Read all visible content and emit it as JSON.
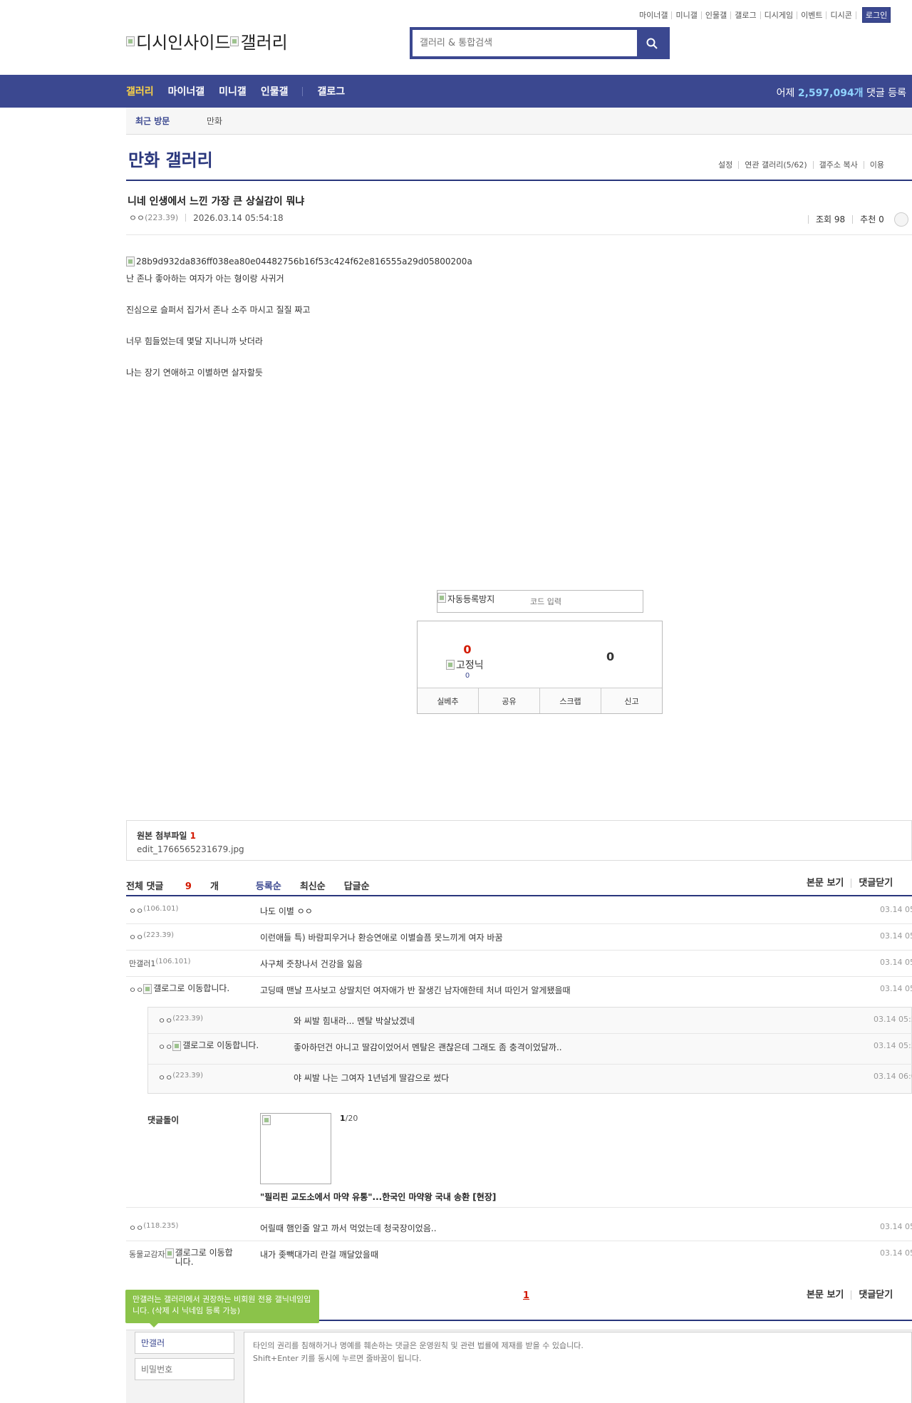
{
  "top_links": [
    "마이너갤",
    "미니갤",
    "인물갤",
    "갤로그",
    "디시게임",
    "이벤트",
    "디시콘"
  ],
  "login_label": "로그인",
  "logo": {
    "alt1": "디시인사이드",
    "alt2": "갤러리"
  },
  "search": {
    "placeholder": "갤러리 & 통합검색"
  },
  "gnb": {
    "items": [
      "갤러리",
      "마이너갤",
      "미니갤",
      "인물갤",
      "갤로그"
    ],
    "right_prefix": "어제 ",
    "right_count": "2,597,094개",
    "right_suffix": " 댓글 등록"
  },
  "recent": {
    "label": "최근 방문",
    "items": [
      "만화"
    ]
  },
  "gallery": {
    "title": "만화 갤러리",
    "options": [
      "설정",
      "연관 갤러리(5/62)",
      "갤주소 복사",
      "이용"
    ]
  },
  "post": {
    "title": "니네 인생에서 느낀 가장 큰 상실감이 뭐냐",
    "author": "ㅇㅇ",
    "ip": "(223.39)",
    "datetime": "2026.03.14 05:54:18",
    "views": "조회 98",
    "recommend": "추천 0",
    "image_alt": "28b9d932da836ff038ea80e04482756b16f53c424f62e816555a29d05800200a",
    "paragraphs": [
      "난 존나 좋아하는 여자가 아는 형이랑 사귀거",
      "진심으로 슬퍼서 집가서 존나 소주 마시고 질질 짜고",
      "너무 힘들었는데 몇달 지나니까 낫더라",
      "나는 장기 연애하고 이별하면 살자할듯"
    ]
  },
  "captcha": {
    "image_alt": "자동등록방지",
    "placeholder": "코드 입력"
  },
  "vote": {
    "up": "0",
    "fixed_alt": "고정닉",
    "fixed_count": "0",
    "down": "0",
    "actions": [
      "실베추",
      "공유",
      "스크랩",
      "신고"
    ]
  },
  "attach": {
    "title": "원본 첨부파일",
    "count": "1",
    "file": "edit_1766565231679.jpg"
  },
  "comments_header": {
    "total_label": "전체 댓글",
    "total_count": "9",
    "total_unit": "개",
    "sorts": [
      "등록순",
      "최신순",
      "답글순"
    ],
    "right": [
      "본문 보기",
      "댓글닫기"
    ]
  },
  "comments": [
    {
      "nick": "ㅇㅇ",
      "ip": "(106.101)",
      "text": "나도 이별 ㅇㅇ",
      "date": "03.14 05"
    },
    {
      "nick": "ㅇㅇ",
      "ip": "(223.39)",
      "text": "이런애들 특) 바람피우거나 환승연애로 이별슬픔 못느끼게 여자 바꿈",
      "date": "03.14 05"
    },
    {
      "nick": "만갤러1",
      "ip": "(106.101)",
      "text": "사구체 줏창나서 건강을 잃음",
      "date": "03.14 05"
    },
    {
      "nick": "ㅇㅇ",
      "lock_alt": "갤로그로 이동합니다.",
      "text": "고딩때 맨날 프사보고 상딸치던 여자애가 반 잘생긴 남자애한테 처녀 따인거 알게됐을때",
      "date": "03.14 05"
    }
  ],
  "replies": [
    {
      "nick": "ㅇㅇ",
      "ip": "(223.39)",
      "text": "와 씨발 힘내라... 멘탈 박살났겠네",
      "date": "03.14 05:5"
    },
    {
      "nick": "ㅇㅇ",
      "lock_alt": "갤로그로 이동합니다.",
      "text": "좋아하던건 아니고 딸감이었어서 멘탈은 괜찮은데 그래도 좀 충격이었달까..",
      "date": "03.14 05:5"
    },
    {
      "nick": "ㅇㅇ",
      "ip": "(223.39)",
      "text": "야 씨발 나는 그여자 1년넘게 딸감으로 썼다",
      "date": "03.14 06:0"
    }
  ],
  "dol": {
    "label": "댓글돌이",
    "page": "1",
    "page_total": "/20",
    "headline": "\"필리핀 교도소에서 마약 유통\"...한국인 마약왕 국내 송환 [현장]"
  },
  "comments2": [
    {
      "nick": "ㅇㅇ",
      "ip": "(118.235)",
      "text": "어릴때 햄인줄 알고 까서 먹었는데 청국장이었음..",
      "date": "03.14 05"
    },
    {
      "nick": "동물교감자",
      "lock_alt": "갤로그로 이동합니다.",
      "text": "내가 좆빽대가리 란걸 깨달았을때",
      "date": "03.14 05"
    }
  ],
  "bottom": {
    "page": "1",
    "right": [
      "본문 보기",
      "댓글닫기"
    ]
  },
  "tooltip": "만갤러는 갤러리에서 권장하는 비회원 전용 갤닉네임입니다. (삭제 시 닉네임 등록 가능)",
  "write": {
    "nick_value": "만갤러",
    "pw_placeholder": "비밀번호",
    "textarea_placeholder": "타인의 권리를 침해하거나 명예를 훼손하는 댓글은 운영원칙 및 관련 법률에 제재를 받을 수 있습니다.\nShift+Enter 키를 동시에 누르면 줄바꿈이 됩니다."
  },
  "colors": {
    "brand": "#3b4890",
    "brand_dark": "#29367c",
    "accent_red": "#d31900",
    "tooltip_green": "#8bc34a",
    "gnb_active": "#fcd346"
  }
}
